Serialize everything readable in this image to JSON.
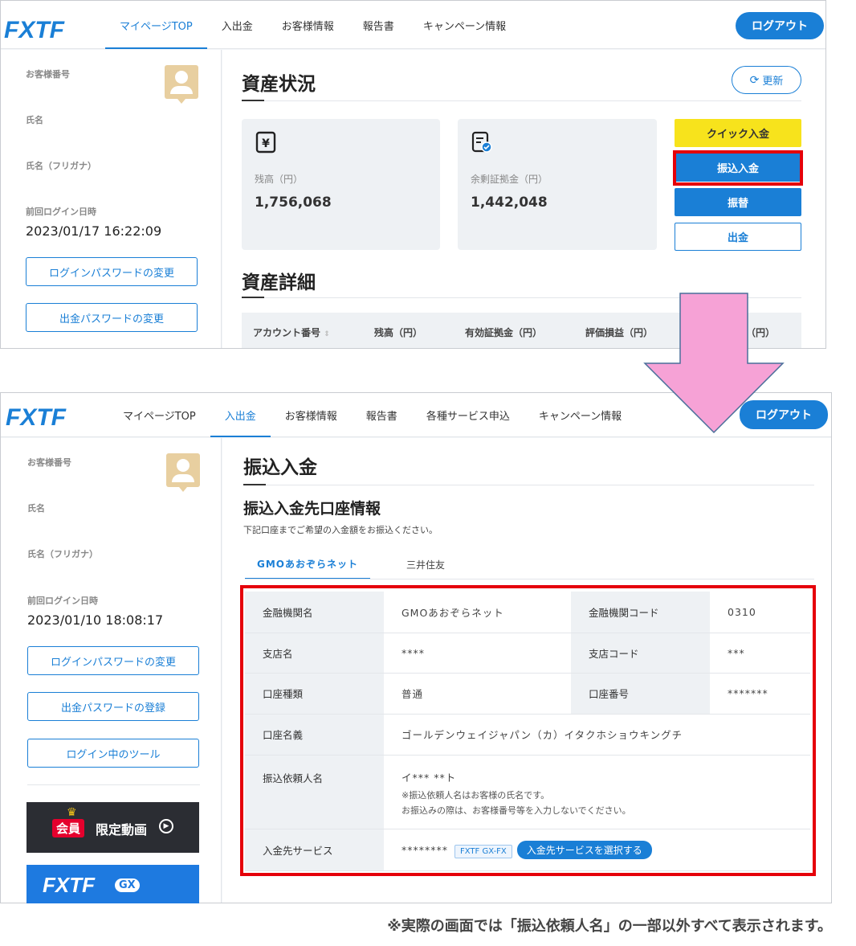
{
  "colors": {
    "brand": "#1a7fd6",
    "highlight": "#e5000a",
    "quick": "#f7e31c",
    "arrow": "#f6a2d6"
  },
  "screen1": {
    "logo": "FXTF",
    "nav": [
      "マイページTOP",
      "入出金",
      "お客様情報",
      "報告書",
      "キャンペーン情報"
    ],
    "logout": "ログアウト",
    "sidebar": {
      "customer_no": "お客様番号",
      "name": "氏名",
      "name_kana": "氏名（フリガナ）",
      "last_login_label": "前回ログイン日時",
      "last_login": "2023/01/17 16:22:09",
      "btn_login_pw": "ログインパスワードの変更",
      "btn_withdraw_pw": "出金パスワードの変更"
    },
    "title": "資産状況",
    "refresh": "更新",
    "cards": [
      {
        "icon": "yen-icon",
        "label": "残高（円）",
        "value": "1,756,068"
      },
      {
        "icon": "margin-doc-icon",
        "label": "余剰証拠金（円）",
        "value": "1,442,048"
      }
    ],
    "actions": {
      "quick": "クイック入金",
      "transfer_deposit": "振込入金",
      "transfer": "振替",
      "withdraw": "出金"
    },
    "detail_title": "資産詳細",
    "table_headers": [
      "アカウント番号",
      "残高（円）",
      "有効証拠金（円）",
      "評価損益（円）",
      "（円）"
    ]
  },
  "screen2": {
    "logo": "FXTF",
    "nav": [
      "マイページTOP",
      "入出金",
      "お客様情報",
      "報告書",
      "各種サービス申込",
      "キャンペーン情報"
    ],
    "logout": "ログアウト",
    "sidebar": {
      "customer_no": "お客様番号",
      "name": "氏名",
      "name_kana": "氏名（フリガナ）",
      "last_login_label": "前回ログイン日時",
      "last_login": "2023/01/10 18:08:17",
      "btn_login_pw": "ログインパスワードの変更",
      "btn_withdraw_pw": "出金パスワードの登録",
      "btn_tools": "ログイン中のツール",
      "promo_badge": "会員",
      "promo_text": "限定動画",
      "promo_logo": "FXTF",
      "promo_logo_gx": "GX"
    },
    "title": "振込入金",
    "subtitle": "振込入金先口座情報",
    "description": "下記口座までご希望の入金額をお振込ください。",
    "tabs": [
      "GMOあおぞらネット",
      "三井住友"
    ],
    "rows": {
      "bank_label": "金融機関名",
      "bank": "GMOあおぞらネット",
      "bank_code_label": "金融機関コード",
      "bank_code": "0310",
      "branch_label": "支店名",
      "branch": "****",
      "branch_code_label": "支店コード",
      "branch_code": "***",
      "acct_type_label": "口座種類",
      "acct_type": "普通",
      "acct_no_label": "口座番号",
      "acct_no": "*******",
      "acct_name_label": "口座名義",
      "acct_name": "ゴールデンウェイジャパン（カ）イタクホショウキングチ",
      "sender_label": "振込依頼人名",
      "sender": "イ*** **ト",
      "sender_note1": "※振込依頼人名はお客様の氏名です。",
      "sender_note2": "お振込みの際は、お客様番号等を入力しないでください。",
      "service_label": "入金先サービス",
      "service_masked": "********",
      "service_tag": "FXTF GX-FX",
      "service_btn": "入金先サービスを選択する"
    }
  },
  "footnote": "※実際の画面では「振込依頼人名」の一部以外すべて表示されます。"
}
